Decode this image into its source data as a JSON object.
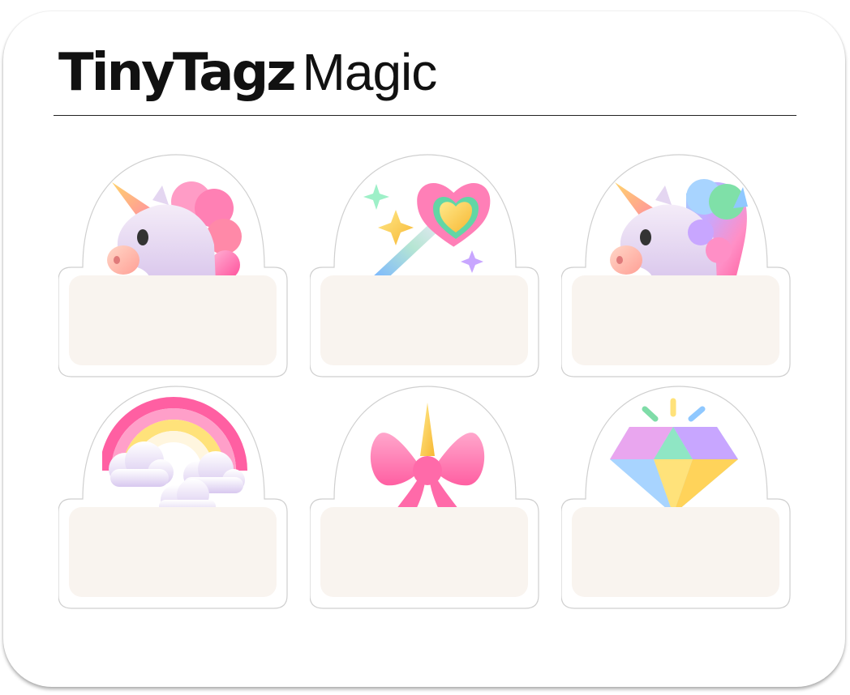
{
  "header": {
    "brand": "TinyTagz",
    "subtitle": "Magic"
  },
  "tags": [
    {
      "icon": "unicorn-pink-icon"
    },
    {
      "icon": "magic-wand-heart-icon"
    },
    {
      "icon": "unicorn-rainbow-icon"
    },
    {
      "icon": "rainbow-clouds-icon"
    },
    {
      "icon": "unicorn-bow-icon"
    },
    {
      "icon": "diamond-icon"
    }
  ],
  "colors": {
    "sheet_background": "#ffffff",
    "label_background": "#f9f4ef",
    "outline": "#cfcfcf",
    "text": "#111111"
  }
}
